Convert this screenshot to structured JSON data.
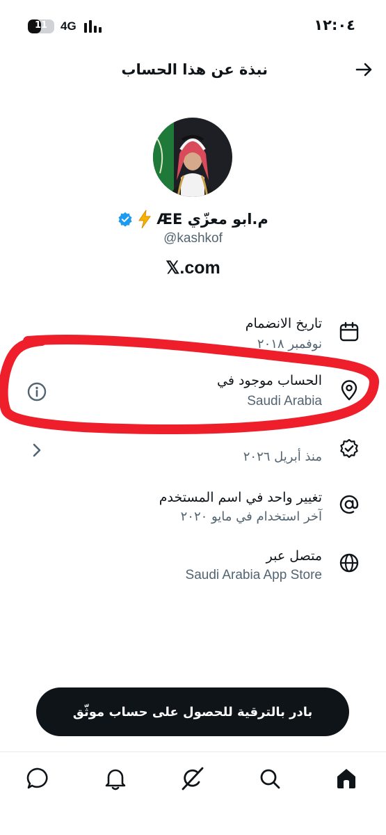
{
  "status": {
    "time": "١٢:٠٤",
    "battery": "11",
    "battery_level": 0.5,
    "network": "4G"
  },
  "header": {
    "title": "نبذة عن هذا الحساب"
  },
  "profile": {
    "display_name": "م.ابو معزّي ÆE",
    "handle": "@kashkof",
    "site": "𝕏.com",
    "verified": true
  },
  "info": [
    {
      "icon": "calendar-icon",
      "title": "تاريخ الانضمام",
      "subtitle": "نوفمبر ٢٠١٨"
    },
    {
      "icon": "location-pin-icon",
      "title": "الحساب موجود في",
      "subtitle": "Saudi Arabia"
    },
    {
      "icon": "verified-badge-icon",
      "title": "",
      "subtitle": "منذ أبريل ٢٠٢٦"
    },
    {
      "icon": "at-sign-icon",
      "title": "تغيير واحد في اسم المستخدم",
      "subtitle": "آخر استخدام في مايو ٢٠٢٠"
    },
    {
      "icon": "globe-icon",
      "title": "متصل عبر",
      "subtitle": "Saudi Arabia App Store"
    }
  ],
  "upgrade_button": "بادر بالترقية للحصول على حساب موثّق",
  "colors": {
    "accent": "#1d9bf0",
    "annotation": "#ee1f2b",
    "text_primary": "#0f1419",
    "text_secondary": "#536471",
    "lightning": "#f4b400"
  },
  "bottom_nav": [
    "home-icon",
    "search-icon",
    "grok-icon",
    "notifications-icon",
    "messages-icon"
  ]
}
